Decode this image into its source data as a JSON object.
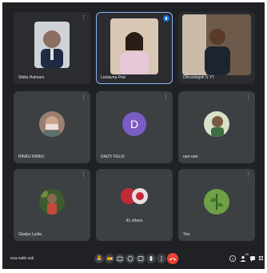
{
  "meeting": {
    "code": "eca-nskk-xsk"
  },
  "participants": [
    {
      "name": "Sibila Hulmani",
      "type": "video"
    },
    {
      "name": "Leelavna Prat",
      "type": "video"
    },
    {
      "name": "Dhruvinigoh S YT",
      "type": "video"
    },
    {
      "name": "RINKU RINKU",
      "type": "avatar"
    },
    {
      "name": "DAIZY FELIX",
      "type": "letter",
      "letter": "D"
    },
    {
      "name": "ram ram",
      "type": "avatar"
    },
    {
      "name": "Gladys Lydia",
      "type": "avatar"
    },
    {
      "name": "41 others",
      "type": "others"
    },
    {
      "name": "You",
      "type": "avatar"
    }
  ],
  "tile_more_glyph": "⋮",
  "colors": {
    "background": "#202124",
    "tile": "#3c4043",
    "end_call": "#ea4335",
    "letter_avatar": "#7b5cc4",
    "active_border": "#8ab4f8"
  },
  "icons": {
    "mic": "mic-icon",
    "camera": "camera-icon",
    "captions": "captions-icon",
    "emoji": "emoji-icon",
    "present": "present-icon",
    "raise_hand": "raise-hand-icon",
    "more": "more-options-icon",
    "end_call": "end-call-icon",
    "info": "info-icon",
    "people": "people-icon",
    "chat": "chat-icon",
    "activities": "activities-icon"
  },
  "people_count": "49"
}
